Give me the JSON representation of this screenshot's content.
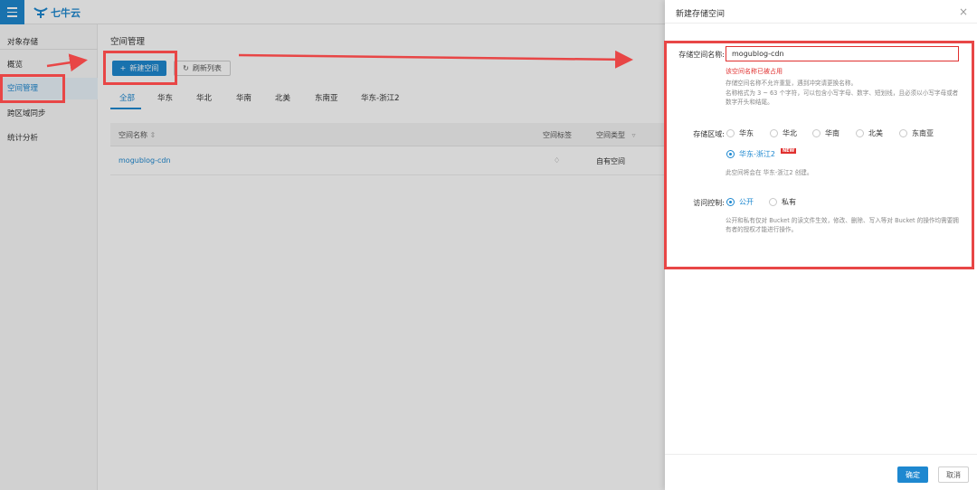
{
  "app": {
    "logo_text": "七牛云"
  },
  "sidebar": {
    "section": "对象存储",
    "items": [
      {
        "label": "概览"
      },
      {
        "label": "空间管理"
      },
      {
        "label": "跨区域同步"
      },
      {
        "label": "统计分析"
      }
    ]
  },
  "main": {
    "title": "空间管理",
    "new_button": "新建空间",
    "refresh_button": "刷新列表",
    "tabs": [
      "全部",
      "华东",
      "华北",
      "华南",
      "北美",
      "东南亚",
      "华东-浙江2"
    ],
    "table": {
      "columns": [
        "空间名称",
        "空间标签",
        "空间类型"
      ],
      "rows": [
        {
          "name": "mogublog-cdn",
          "type": "自有空间"
        }
      ]
    }
  },
  "drawer": {
    "title": "新建存储空间",
    "name_label": "存储空间名称:",
    "name_value": "mogublog-cdn",
    "name_error": "该空间名称已被占用",
    "name_hint_1": "存储空间名称不允许重复，遇到冲突请更换名称。",
    "name_hint_2": "名称格式为 3 ~ 63 个字符，可以包含小写字母、数字、短划线，且必须以小写字母或者数字开头和结尾。",
    "region_label": "存储区域:",
    "regions": [
      "华东",
      "华北",
      "华南",
      "北美",
      "东南亚",
      "华东-浙江2"
    ],
    "selected_region": "华东-浙江2",
    "new_badge": "NEW",
    "region_hint": "此空间将会在 华东-浙江2 创建。",
    "access_label": "访问控制:",
    "access_options": [
      "公开",
      "私有"
    ],
    "selected_access": "公开",
    "access_hint": "公开和私有仅对 Bucket 的读文件生效，修改、删除、写入等对 Bucket 的操作均需要拥有者的授权才能进行操作。",
    "ok_button": "确定",
    "cancel_button": "取消"
  },
  "colors": {
    "accent": "#1e88d0",
    "error": "#e0302f",
    "annotation": "#e84646"
  }
}
